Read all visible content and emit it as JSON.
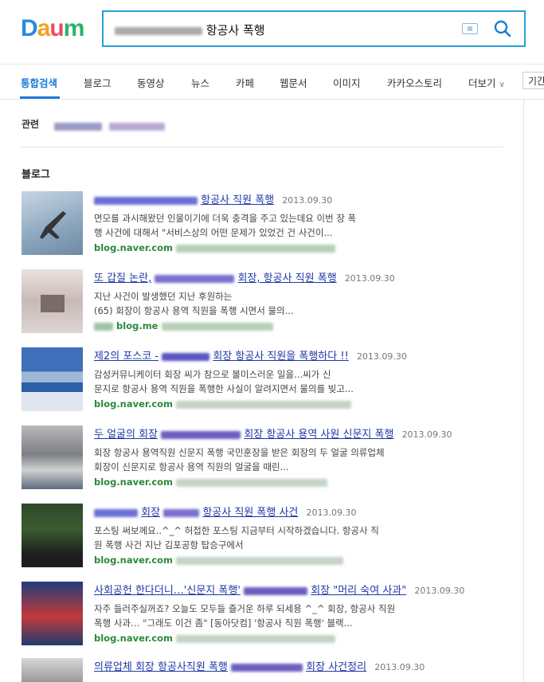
{
  "header": {
    "logo": "Daum",
    "search_query": "항공사 폭행"
  },
  "tabs": [
    {
      "label": "통합검색",
      "active": true
    },
    {
      "label": "블로그"
    },
    {
      "label": "동영상"
    },
    {
      "label": "뉴스"
    },
    {
      "label": "카페"
    },
    {
      "label": "웹문서"
    },
    {
      "label": "이미지"
    },
    {
      "label": "카카오스토리"
    },
    {
      "label": "더보기"
    }
  ],
  "period_label": "기간",
  "related_label": "관련",
  "section_title": "블로그",
  "results": [
    {
      "title_a": "항공사 직원 폭행",
      "date": "2013.09.30",
      "desc1": "면모를 과시해왔던 인물이기에 더욱 충격을 주고 있는데요 이번 장 폭",
      "desc2": "행 사건에 대해서 \"서비스상의 어떤 문제가 있었건 건 사건이...",
      "url": "blog.naver.com"
    },
    {
      "title_a": "또 갑질 논란,",
      "title_b": "회장, 항공사 직원 폭행",
      "date": "2013.09.30",
      "desc1": "지난 사건이 발생했던 지난 후원하는",
      "desc2": "(65) 회장이 항공사 용역 직원을 폭행 시면서 물의...",
      "url": "blog.me"
    },
    {
      "title_a": "제2의 포스코 -",
      "title_b": "회장 항공사 직원을 폭행하다 !!",
      "date": "2013.09.30",
      "desc1": "감성커뮤니케이터 회장 씨가 참으로 볼미스러운 일을...씨가 신",
      "desc2": "문지로 항공사 용역 직원을 폭행한 사실이 알려지면서 물의를 빚고...",
      "url": "blog.naver.com"
    },
    {
      "title_a": "두 얼굴의 회장",
      "title_b": "회장 항공사 용역 사원 신문지 폭행",
      "date": "2013.09.30",
      "desc1": "회장 항공사 용역직원 신문지 폭행 국민훈장을 받은 회장의 두 얼굴 의류업체",
      "desc2": "회장이 신문지로 항공사 용역 직원의 얼굴을 때린...",
      "url": "blog.naver.com"
    },
    {
      "title_a": "회장",
      "title_b": "항공사 직원 폭행 사건",
      "date": "2013.09.30",
      "desc1": "포스팅 써보께요..^_^ 허접한 포스팅 지금부터 시작하겠습니다. 항공사 직",
      "desc2": "원 폭행 사건 지난 김포공항 탑승구에서",
      "url": "blog.naver.com"
    },
    {
      "title_a": "사회공헌 한다더니…'신문지 폭행'",
      "title_b": "회장 \"머리 숙여 사과\"",
      "date": "2013.09.30",
      "desc1": "자주 들러주실꺼죠? 오늘도 모두들 즐거운 하루 되세용 ^_^ 회장, 항공사 직원",
      "desc2": "폭행 사과… \"그래도 이건 좀\" [동아닷컴] '항공사 직원 폭행' 블랙...",
      "url": "blog.naver.com"
    },
    {
      "title_a": "의류업체 회장 항공사직원 폭행",
      "title_b": "회장 사건정리",
      "date": "2013.09.30",
      "desc1": "",
      "desc2": "",
      "url": ""
    }
  ]
}
